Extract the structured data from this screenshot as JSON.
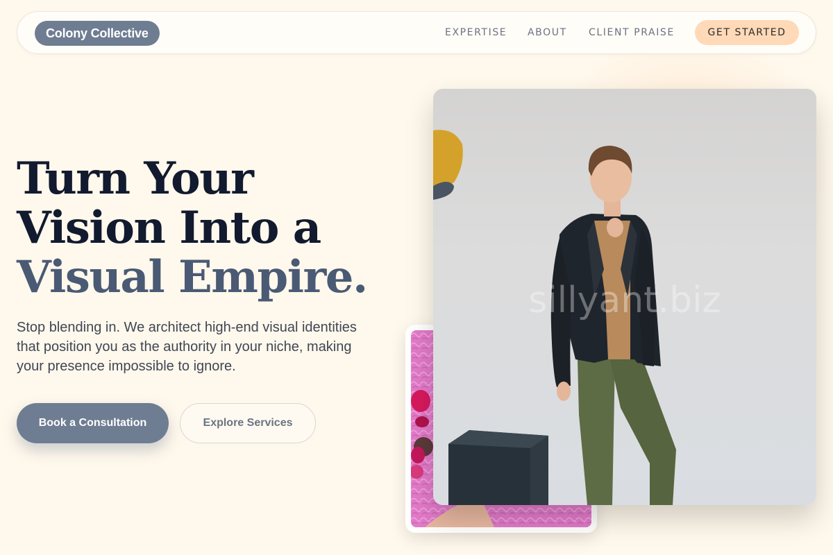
{
  "nav": {
    "logo": "Colony Collective",
    "links": [
      "EXPERTISE",
      "ABOUT",
      "CLIENT PRAISE"
    ],
    "cta": "GET STARTED"
  },
  "hero": {
    "headline_line1": "Turn Your",
    "headline_line2": "Vision Into a",
    "headline_accent": "Visual Empire.",
    "subtitle": "Stop blending in. We architect high-end visual identities that position you as the authority in your niche, making your presence impossible to ignore.",
    "primary_button": "Book a Consultation",
    "secondary_button": "Explore Services"
  },
  "images": {
    "main_photo": "man-in-black-blazer-photo",
    "thumb_photo": "pink-fur-candy-photo",
    "watermark": "sillyant.biz"
  },
  "colors": {
    "background": "#fff8ec",
    "logo_bg": "#6f7d92",
    "cta_bg": "#ffd9b8",
    "headline": "#111a2e",
    "accent": "#4a5a74"
  }
}
